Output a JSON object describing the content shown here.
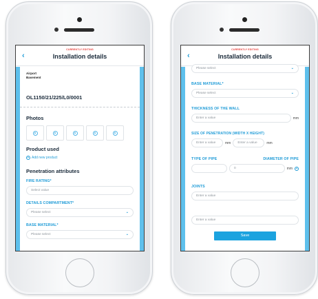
{
  "left": {
    "header": {
      "editing": "CURRENTLY EDITING",
      "title": "Installation details",
      "back": "‹"
    },
    "location": {
      "line1": "Airport",
      "line2": "Basement"
    },
    "code": "OL1150/21/225/L0/0001",
    "photos": {
      "title": "Photos",
      "count": 5
    },
    "product": {
      "title": "Product used",
      "add": "Add new product"
    },
    "attributes": {
      "title": "Penetration attributes"
    },
    "fire_rating": {
      "label": "FIRE RATING*",
      "placeholder": "Select value"
    },
    "compartment": {
      "label": "DETAILS COMPARTMENT*",
      "value": "Please select"
    },
    "base_material": {
      "label": "BASE MATERIAL*",
      "value": "Please select"
    }
  },
  "right": {
    "header": {
      "editing": "CURRENTLY EDITING",
      "title": "Installation details",
      "back": "‹"
    },
    "top_select": {
      "value": "Please select"
    },
    "base_material": {
      "label": "BASE MATERIAL*",
      "value": "Please select"
    },
    "wall_thickness": {
      "label": "THICKNESS OF THE WALL",
      "placeholder": "Enter a value",
      "unit": "mm"
    },
    "penetration_size": {
      "label": "SIZE OF PENETRATION (WIDTH X HEIGHT)",
      "width_placeholder": "Enter a value",
      "height_placeholder": "Enter a value",
      "unit": "mm"
    },
    "pipe": {
      "type_label": "TYPE OF PIPE",
      "diameter_label": "DIAMETER OF PIPE",
      "diameter_value": "0",
      "unit": "mm"
    },
    "joints": {
      "label": "JOINTS",
      "placeholder": "Enter a value"
    },
    "extra": {
      "placeholder": "Enter a value"
    },
    "save": "Save"
  },
  "icons": {
    "chevron": "⌄",
    "plus": "+",
    "camera": "camera-icon"
  }
}
